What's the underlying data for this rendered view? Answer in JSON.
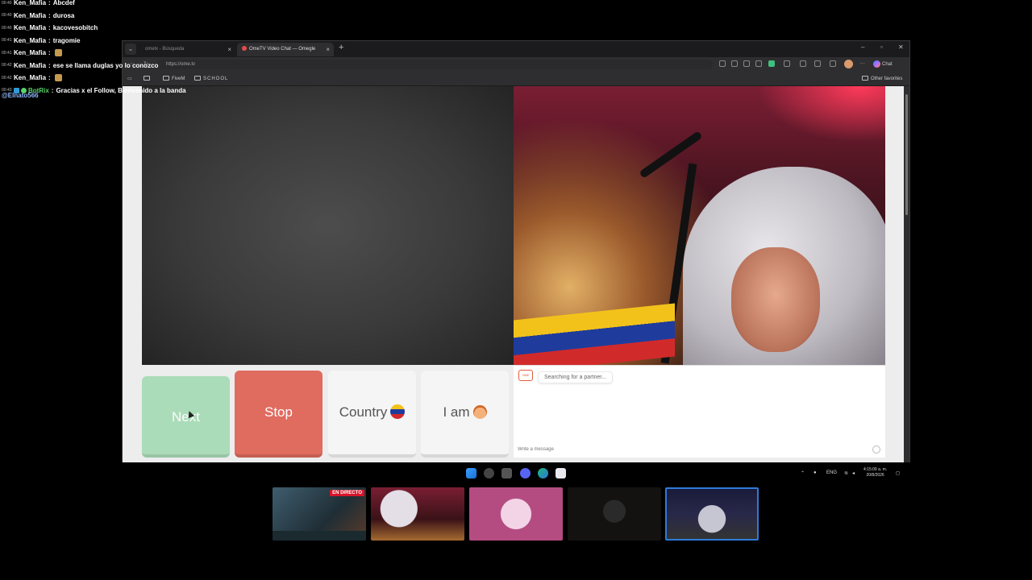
{
  "chat": {
    "messages": [
      {
        "time": "00:40",
        "user": "Ken_Mafia",
        "text": "Abcdef"
      },
      {
        "time": "00:40",
        "user": "Ken_Mafia",
        "text": "durosa"
      },
      {
        "time": "00:40",
        "user": "Ken_Mafia",
        "text": "kacovesobitch"
      },
      {
        "time": "00:41",
        "user": "Ken_Mafia",
        "text": "tragomie"
      },
      {
        "time": "00:41",
        "user": "Ken_Mafia",
        "text": ""
      },
      {
        "time": "00:42",
        "user": "Ken_Mafia",
        "text": "ese se llama duglas yo lo conozco"
      },
      {
        "time": "00:42",
        "user": "Ken_Mafia",
        "text": ""
      },
      {
        "time": "00:43",
        "user": "BotRix",
        "text": "Gracias x el Follow, Bienvenido a la banda"
      }
    ],
    "mention": "@Elnato566"
  },
  "browser": {
    "tabs": [
      {
        "label": "omelx - Búsqueda"
      },
      {
        "label": "OmeTV Video Chat — Omegle"
      }
    ],
    "url": "https://ome.tv",
    "copilot_label": "Chat",
    "favorites": [
      {
        "label": "FiveM"
      },
      {
        "label": "SCHOOL"
      }
    ],
    "other_favorites": "Other favorites"
  },
  "controls": {
    "next_label": "Next",
    "stop_label": "Stop",
    "country_label": "Country",
    "iam_label": "I am"
  },
  "chatbox": {
    "logo_text": "OME",
    "status": "Searching for a partner...",
    "input_placeholder": "Write a message"
  },
  "taskbar": {
    "lang": "ENG",
    "time": "4:15:09 a. m.",
    "date": "20/8/2026"
  },
  "stream": {
    "live_badge": "EN DIRECTO"
  },
  "colors": {
    "next_button": "#9fdab1",
    "stop_button": "#e06b5f",
    "thumbnail_active_border": "#2e7bd9",
    "live_badge": "#d7152a"
  }
}
